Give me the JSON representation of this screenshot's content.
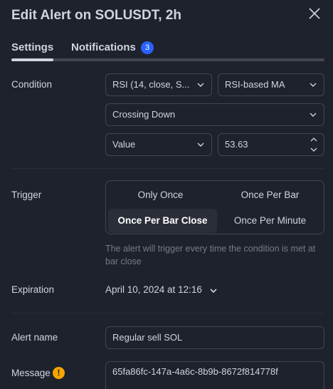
{
  "dialog": {
    "title": "Edit Alert on SOLUSDT, 2h",
    "close_icon": "close-icon"
  },
  "tabs": [
    {
      "label": "Settings",
      "active": true
    },
    {
      "label": "Notifications",
      "badge": "3"
    }
  ],
  "condition": {
    "label": "Condition",
    "indicator": "RSI (14, close, S...",
    "target": "RSI-based MA",
    "operator": "Crossing Down",
    "value_type": "Value",
    "value": "53.63"
  },
  "trigger": {
    "label": "Trigger",
    "options": [
      "Only Once",
      "Once Per Bar",
      "Once Per Bar Close",
      "Once Per Minute"
    ],
    "selected": "Once Per Bar Close",
    "hint": "The alert will trigger every time the condition is met at bar close"
  },
  "expiration": {
    "label": "Expiration",
    "value": "April 10, 2024 at 12:16"
  },
  "alert_name": {
    "label": "Alert name",
    "value": "Regular sell SOL"
  },
  "message": {
    "label": "Message",
    "value": "65fa86fc-147a-4a6c-8b9b-8672f814778f",
    "warning_icon": "warning-icon"
  },
  "colors": {
    "background": "#1e222d",
    "accent": "#2962ff",
    "warning": "#f7a600",
    "border": "#434651"
  }
}
